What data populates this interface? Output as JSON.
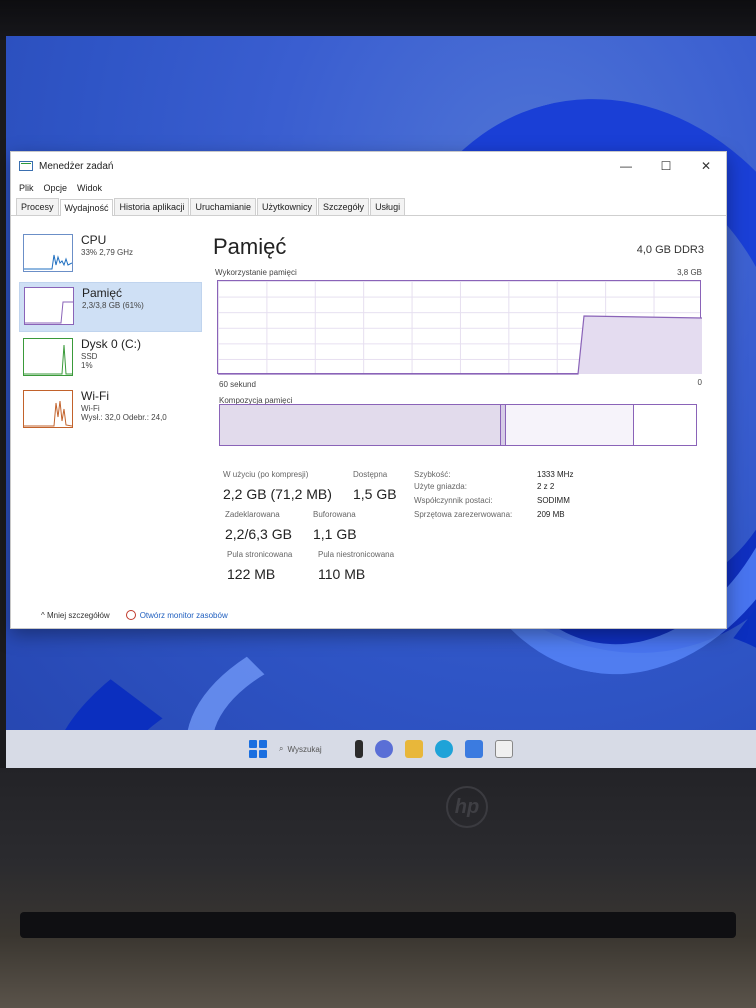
{
  "window": {
    "title": "Menedżer zadań",
    "controls": {
      "minimize": "—",
      "maximize": "☐",
      "close": "✕"
    }
  },
  "menu": [
    "Plik",
    "Opcje",
    "Widok"
  ],
  "tabs": [
    "Procesy",
    "Wydajność",
    "Historia aplikacji",
    "Uruchamianie",
    "Użytkownicy",
    "Szczegóły",
    "Usługi"
  ],
  "active_tab": "Wydajność",
  "sidebar": [
    {
      "title": "CPU",
      "sub1": "33% 2,79 GHz",
      "sub2": ""
    },
    {
      "title": "Pamięć",
      "sub1": "2,3/3,8 GB (61%)",
      "sub2": ""
    },
    {
      "title": "Dysk 0 (C:)",
      "sub1": "SSD",
      "sub2": "1%"
    },
    {
      "title": "Wi-Fi",
      "sub1": "Wi-Fi",
      "sub2": "Wysł.: 32,0 Odebr.: 24,0"
    }
  ],
  "main": {
    "title": "Pamięć",
    "type": "4,0 GB DDR3",
    "usage_label": "Wykorzystanie pamięci",
    "usage_max": "3,8 GB",
    "time_label": "60 sekund",
    "zero_label": "0",
    "composition_label": "Kompozycja pamięci",
    "stats": {
      "in_use_label": "W użyciu (po kompresji)",
      "in_use": "2,2 GB (71,2 MB)",
      "available_label": "Dostępna",
      "available": "1,5 GB",
      "committed_label": "Zadeklarowana",
      "committed": "2,2/6,3 GB",
      "cached_label": "Buforowana",
      "cached": "1,1 GB",
      "paged_label": "Pula stronicowana",
      "paged": "122 MB",
      "nonpaged_label": "Pula niestronicowana",
      "nonpaged": "110 MB"
    },
    "details": [
      {
        "label": "Szybkość:",
        "value": "1333 MHz"
      },
      {
        "label": "Użyte gniazda:",
        "value": "2 z 2"
      },
      {
        "label": "Współczynnik postaci:",
        "value": "SODIMM"
      },
      {
        "label": "Sprzętowa zarezerwowana:",
        "value": "209 MB"
      }
    ]
  },
  "footer": {
    "less_details": "Mniej szczegółów",
    "open_monitor": "Otwórz monitor zasobów"
  },
  "taskbar": {
    "search": "Wyszukaj"
  },
  "laptop": {
    "brand": "hp"
  },
  "colors": {
    "memory": "#8a63b8",
    "cpu": "#1f6fc0",
    "disk": "#3a9a3a",
    "wifi": "#c2622b",
    "selection": "#cfe0f5"
  }
}
